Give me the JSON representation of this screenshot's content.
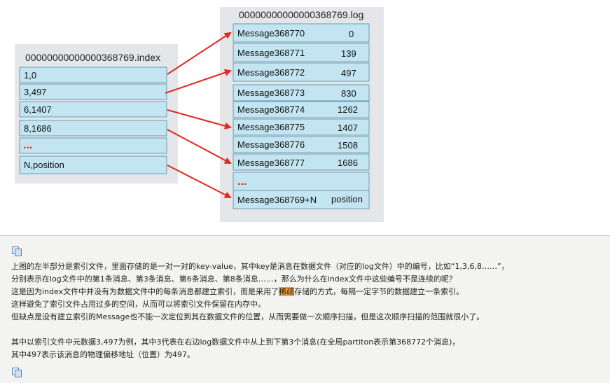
{
  "diagram": {
    "index_title": "00000000000000368769.index",
    "log_title": "00000000000000368769.log",
    "index_rows": [
      "1,0",
      "3,497",
      "6,1407",
      "8,1686",
      "...",
      "N,position"
    ],
    "log_rows": [
      {
        "msg": "Message368770",
        "pos": "0"
      },
      {
        "msg": "Message368771",
        "pos": "139"
      },
      {
        "msg": "Message368772",
        "pos": "497"
      },
      {
        "msg": "Message368773",
        "pos": "830"
      },
      {
        "msg": "Message368774",
        "pos": "1262"
      },
      {
        "msg": "Message368775",
        "pos": "1407"
      },
      {
        "msg": "Message368776",
        "pos": "1508"
      },
      {
        "msg": "Message368777",
        "pos": "1686"
      },
      {
        "msg": "...",
        "pos": ""
      },
      {
        "msg": "Message368769+N",
        "pos": "position"
      }
    ],
    "colors": {
      "box_bg": "#e5e6e9",
      "row_fill": "#c3e5f2",
      "row_border": "#6a9cb0",
      "arrow": "#e2291c"
    }
  },
  "text": {
    "line1": "上图的左半部分是索引文件，里面存储的是一对一对的key-value，其中key是消息在数据文件（对应的log文件）中的编号，比如“1,3,6,8……”，",
    "line2": "分别表示在log文件中的第1条消息、第3条消息、第6条消息、第8条消息……，那么为什么在index文件中这些编号不是连续的呢？",
    "line3_a": "这是因为index文件中并没有为数据文件中的每条消息都建立索引，而是采用了",
    "line3_hl": "稀疏",
    "line3_b": "存储的方式，每隔一定字节的数据建立一条索引。",
    "line4": "这样避免了索引文件占用过多的空间，从而可以将索引文件保留在内存中。",
    "line5": "但缺点是没有建立索引的Message也不能一次定位到其在数据文件的位置，从而需要做一次顺序扫描，但是这次顺序扫描的范围就很小了。",
    "line6": "其中以索引文件中元数据3,497为例，其中3代表在右边log数据文件中从上到下第3个消息(在全局partiton表示第368772个消息)，",
    "line7": "其中497表示该消息的物理偏移地址（位置）为497。"
  },
  "icons": [
    "copy-icon",
    "copy-icon"
  ]
}
